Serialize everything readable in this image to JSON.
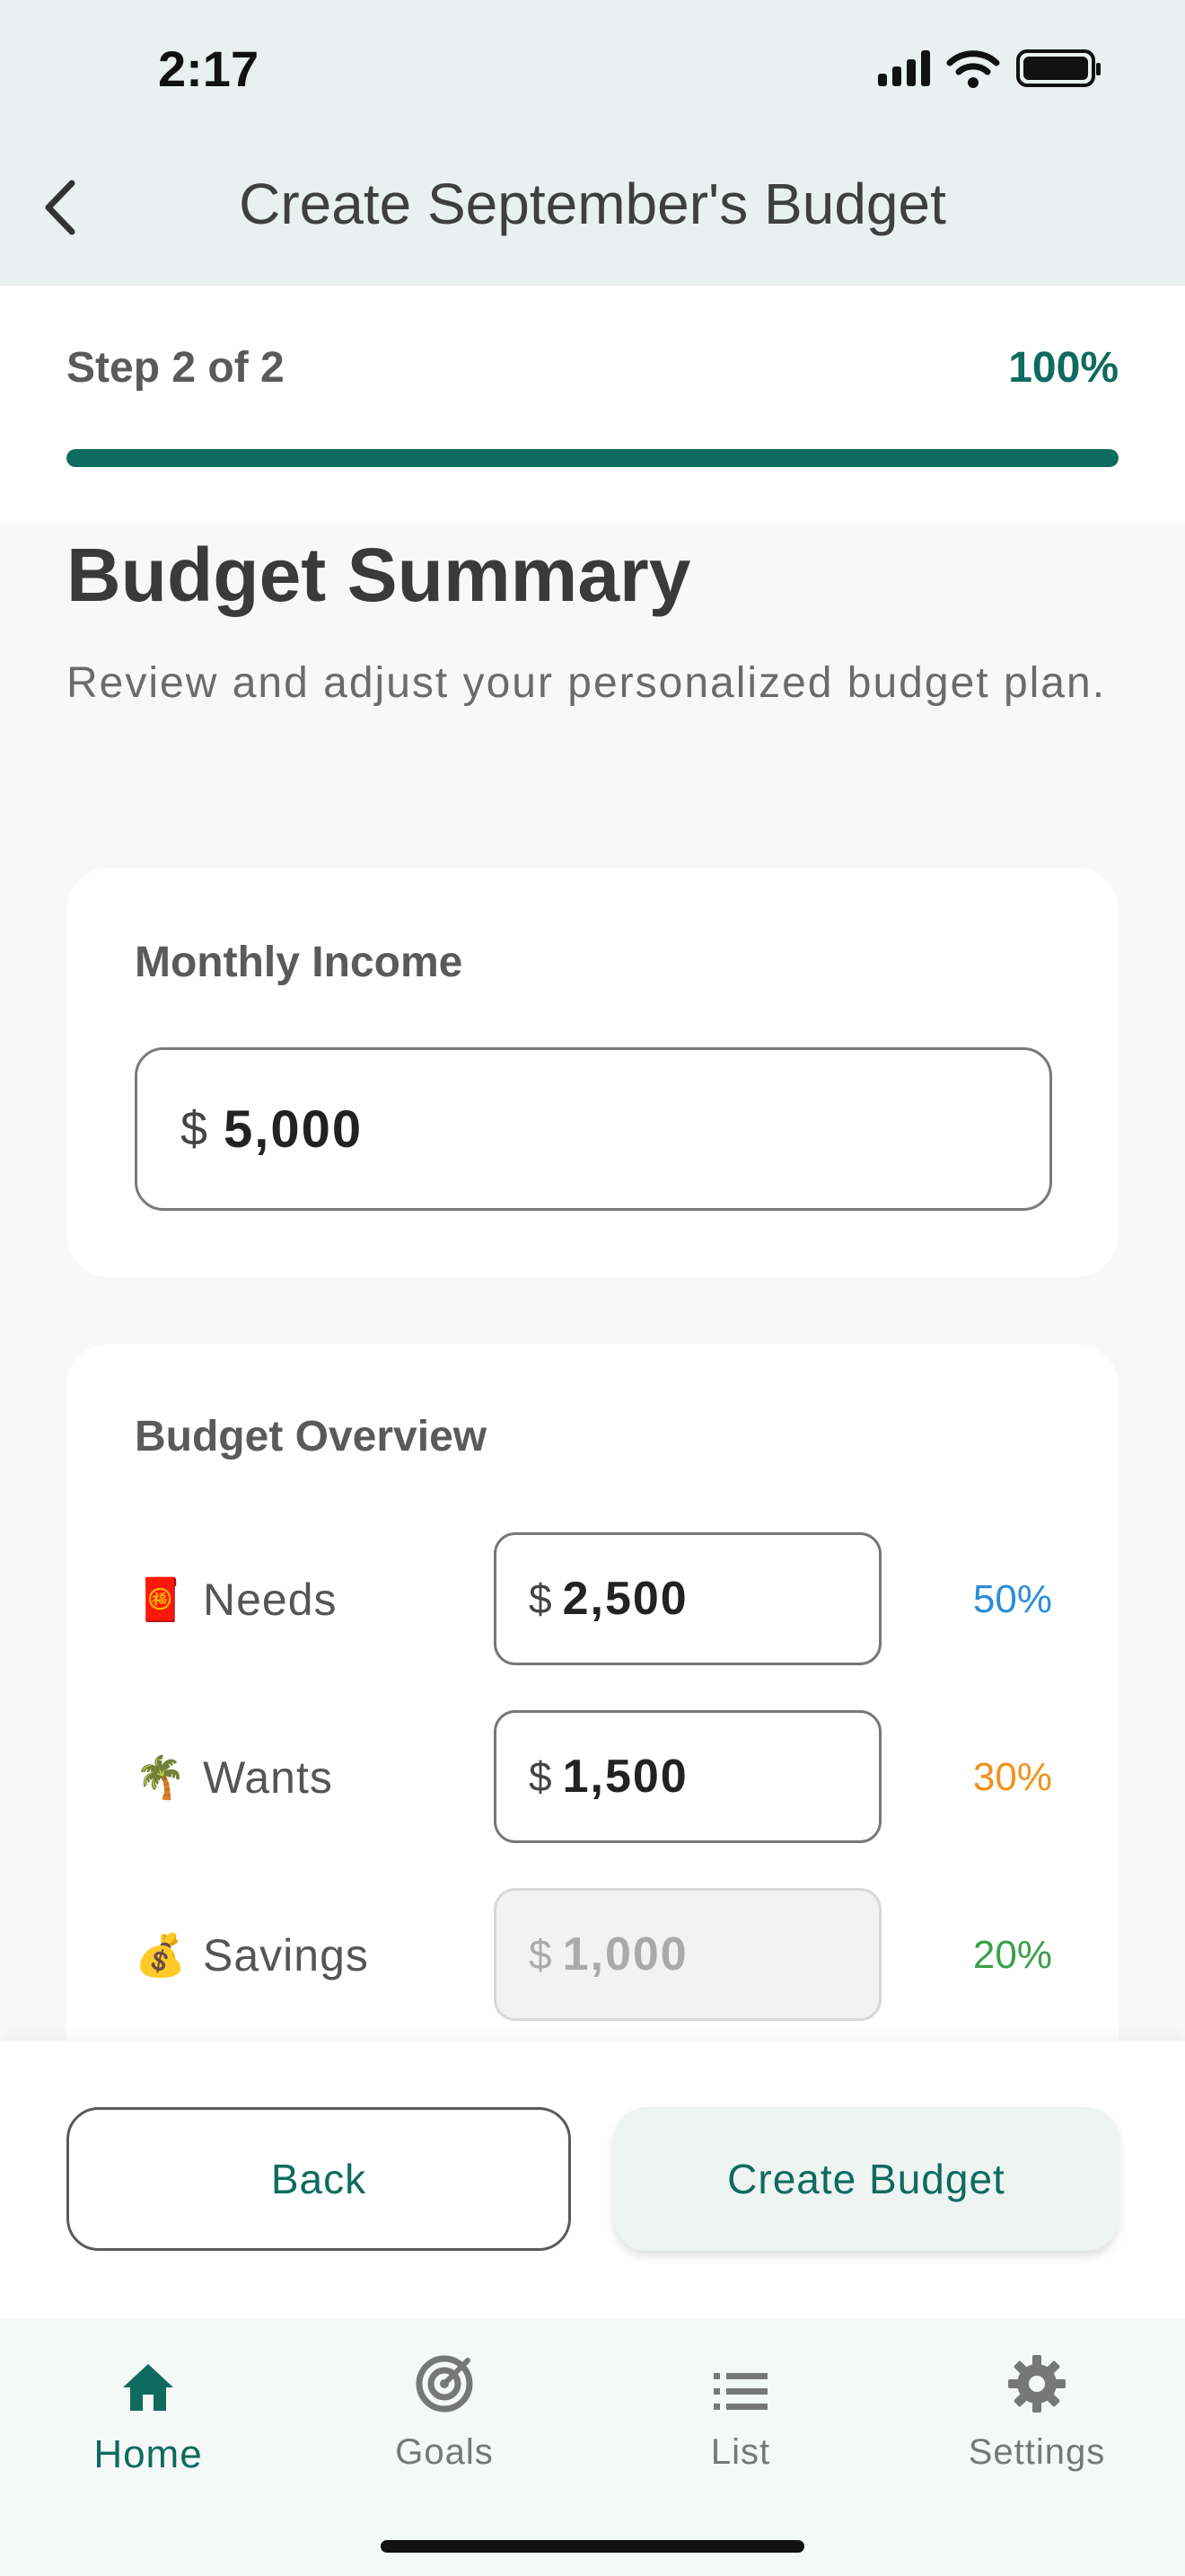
{
  "status_bar": {
    "time": "2:17"
  },
  "header": {
    "title": "Create September's Budget"
  },
  "progress": {
    "step_label": "Step 2 of 2",
    "percent_label": "100%",
    "fraction": 1.0
  },
  "main": {
    "title": "Budget Summary",
    "subtitle": "Review and adjust your personalized budget plan."
  },
  "income_card": {
    "label": "Monthly Income",
    "currency": "$",
    "value": "5,000"
  },
  "overview": {
    "label": "Budget Overview",
    "rows": [
      {
        "icon": "🧧",
        "name": "Needs",
        "currency": "$",
        "value": "2,500",
        "percent": "50%",
        "color": "#2a8fd6",
        "editable": true
      },
      {
        "icon": "🌴",
        "name": "Wants",
        "currency": "$",
        "value": "1,500",
        "percent": "30%",
        "color": "#f0921e",
        "editable": true
      },
      {
        "icon": "💰",
        "name": "Savings",
        "currency": "$",
        "value": "1,000",
        "percent": "20%",
        "color": "#3aa04a",
        "editable": false
      }
    ]
  },
  "actions": {
    "back_label": "Back",
    "create_label": "Create Budget"
  },
  "tabs": [
    {
      "label": "Home",
      "icon": "home-icon",
      "active": true
    },
    {
      "label": "Goals",
      "icon": "target-icon",
      "active": false
    },
    {
      "label": "List",
      "icon": "list-icon",
      "active": false
    },
    {
      "label": "Settings",
      "icon": "gear-icon",
      "active": false
    }
  ],
  "colors": {
    "accent": "#0e6b5e",
    "header_bg": "#e9f1f0"
  }
}
